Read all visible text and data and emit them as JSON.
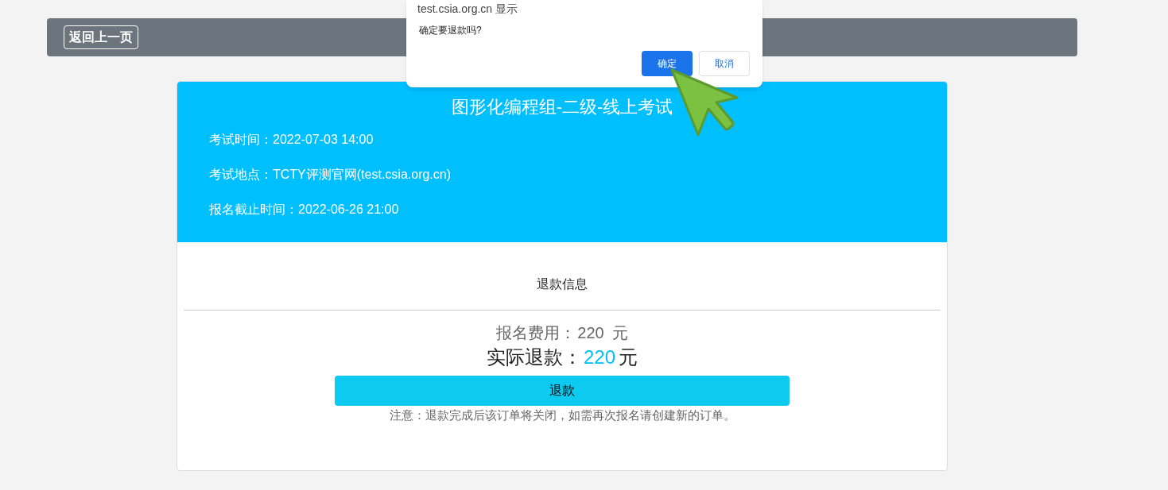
{
  "back_button": {
    "label": "返回上一页"
  },
  "exam": {
    "title": "图形化编程组-二级-线上考试",
    "details": [
      "考试时间：2022-07-03 14:00",
      "考试地点：TCTY评测官网(test.csia.org.cn)",
      "报名截止时间：2022-06-26 21:00"
    ]
  },
  "refund": {
    "heading": "退款信息",
    "fee_label": "报名费用：",
    "fee_amount": "220",
    "fee_unit": "元",
    "actual_label": "实际退款：",
    "actual_amount": "220",
    "actual_unit": "元",
    "button": "退款",
    "note": "注意：退款完成后该订单将关闭，如需再次报名请创建新的订单。"
  },
  "dialog": {
    "origin": "test.csia.org.cn 显示",
    "message": "确定要退款吗?",
    "confirm": "确定",
    "cancel": "取消"
  }
}
